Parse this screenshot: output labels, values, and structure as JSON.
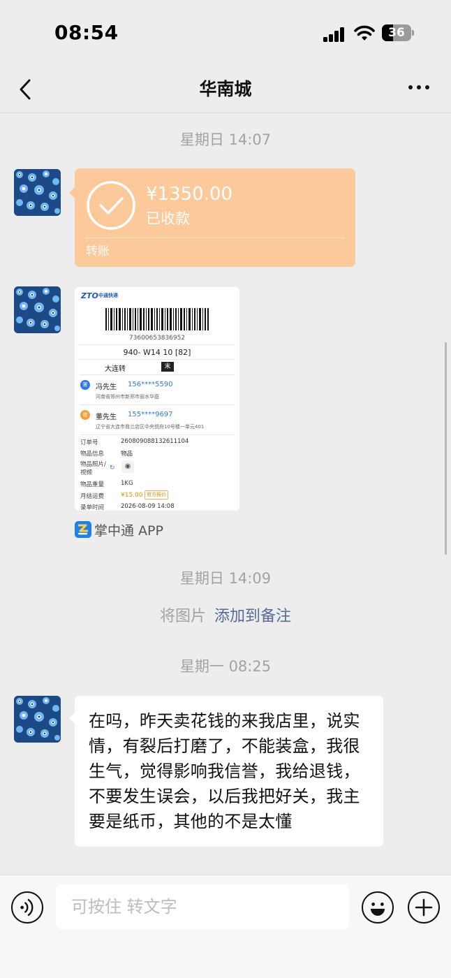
{
  "status_bar": {
    "time": "08:54",
    "battery": "36"
  },
  "nav": {
    "title": "华南城",
    "back_icon": "chevron-left-icon",
    "more_icon": "more-dots-icon"
  },
  "timestamps": [
    "星期日 14:07",
    "星期日 14:09",
    "星期一 08:25"
  ],
  "transfer": {
    "amount": "¥1350.00",
    "status": "已收款",
    "label": "转账",
    "color": "#fcc99a"
  },
  "waybill": {
    "logo": "ZTO",
    "logo_cn": "中通快递",
    "tracking_number": "73600653836952",
    "route_code": "940- W14 10 [82]",
    "sort_center": "大连转",
    "sort_tag": "末",
    "sender": {
      "badge": "寄",
      "name": "冯先生",
      "phone": "156****5590",
      "address": "河南省郑州市新郑市丽水华庭"
    },
    "receiver": {
      "badge": "收",
      "name": "董先生",
      "phone": "155****9697",
      "address": "辽宁省大连市普兰店区中央悦府10号楼一单元401"
    },
    "fields": [
      {
        "key": "订单号",
        "value": "2608090881326111​04"
      },
      {
        "key": "物品信息",
        "value": "物品"
      },
      {
        "key": "物品照片/视频",
        "value": ""
      },
      {
        "key": "物品重量",
        "value": "1KG"
      },
      {
        "key": "月结运费",
        "value": "¥15.00"
      },
      {
        "key": "录单时间",
        "value": "2026-08-09 14:08"
      }
    ],
    "fee_badge": "官方报价"
  },
  "source_app": {
    "name": "掌中通 APP"
  },
  "system_note": {
    "plain": "将图片",
    "link": "添加到备注"
  },
  "message": {
    "text": "在吗，昨天卖花钱的来我店里，说实情，有裂后打磨了，不能装盒，我很生气，觉得影响我信誉，我给退钱，不要发生误会，以后我把好关，我主要是纸币，其他的不是太懂"
  },
  "input_bar": {
    "placeholder": "可按住 转文字",
    "value": ""
  },
  "colors": {
    "background": "#ededed",
    "link": "#576b95",
    "bubble": "#ffffff"
  }
}
